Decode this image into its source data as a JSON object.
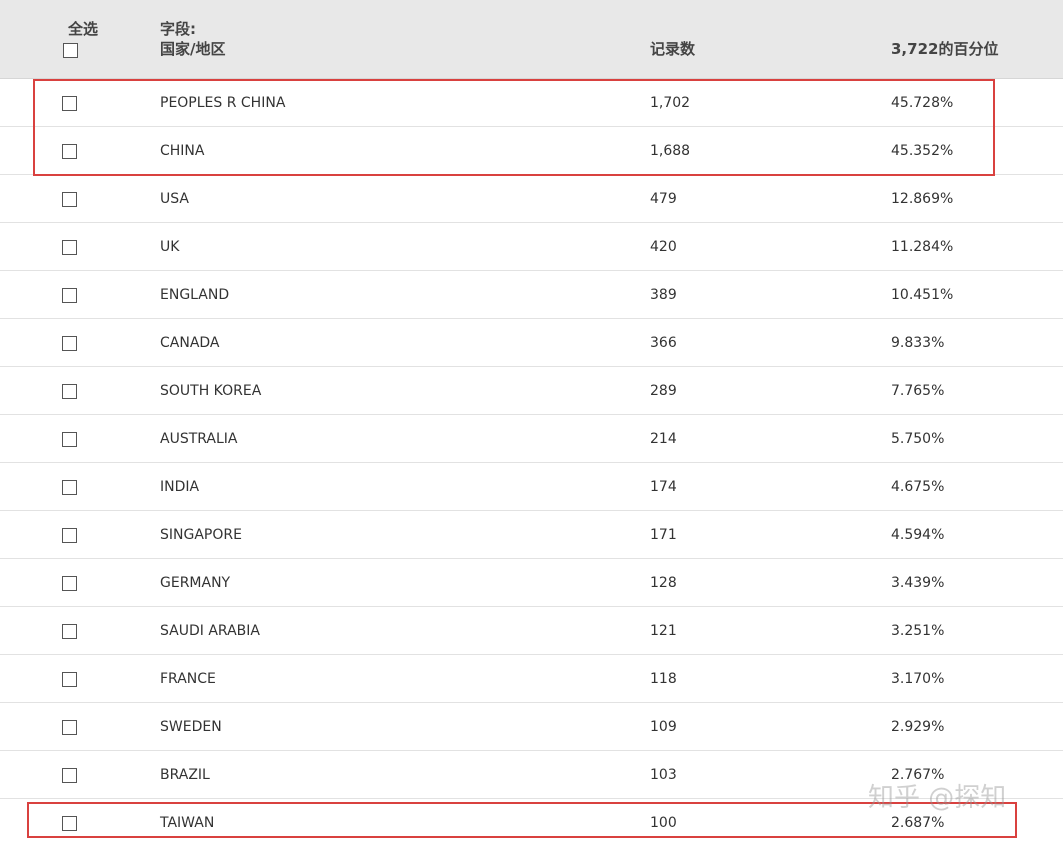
{
  "header": {
    "select_all_label": "全选",
    "field_label": "字段:",
    "field_name": "国家/地区",
    "count_label": "记录数",
    "percent_label": "3,722的百分位"
  },
  "rows": [
    {
      "name": "PEOPLES R CHINA",
      "count": "1,702",
      "percent": "45.728%"
    },
    {
      "name": "CHINA",
      "count": "1,688",
      "percent": "45.352%"
    },
    {
      "name": "USA",
      "count": "479",
      "percent": "12.869%"
    },
    {
      "name": "UK",
      "count": "420",
      "percent": "11.284%"
    },
    {
      "name": "ENGLAND",
      "count": "389",
      "percent": "10.451%"
    },
    {
      "name": "CANADA",
      "count": "366",
      "percent": "9.833%"
    },
    {
      "name": "SOUTH KOREA",
      "count": "289",
      "percent": "7.765%"
    },
    {
      "name": "AUSTRALIA",
      "count": "214",
      "percent": "5.750%"
    },
    {
      "name": "INDIA",
      "count": "174",
      "percent": "4.675%"
    },
    {
      "name": "SINGAPORE",
      "count": "171",
      "percent": "4.594%"
    },
    {
      "name": "GERMANY",
      "count": "128",
      "percent": "3.439%"
    },
    {
      "name": "SAUDI ARABIA",
      "count": "121",
      "percent": "3.251%"
    },
    {
      "name": "FRANCE",
      "count": "118",
      "percent": "3.170%"
    },
    {
      "name": "SWEDEN",
      "count": "109",
      "percent": "2.929%"
    },
    {
      "name": "BRAZIL",
      "count": "103",
      "percent": "2.767%"
    },
    {
      "name": "TAIWAN",
      "count": "100",
      "percent": "2.687%"
    }
  ],
  "watermark": "知乎 @探知",
  "colors": {
    "header_bg": "#e8e8e8",
    "highlight": "#d9413f",
    "row_border": "#e2e2e2"
  }
}
